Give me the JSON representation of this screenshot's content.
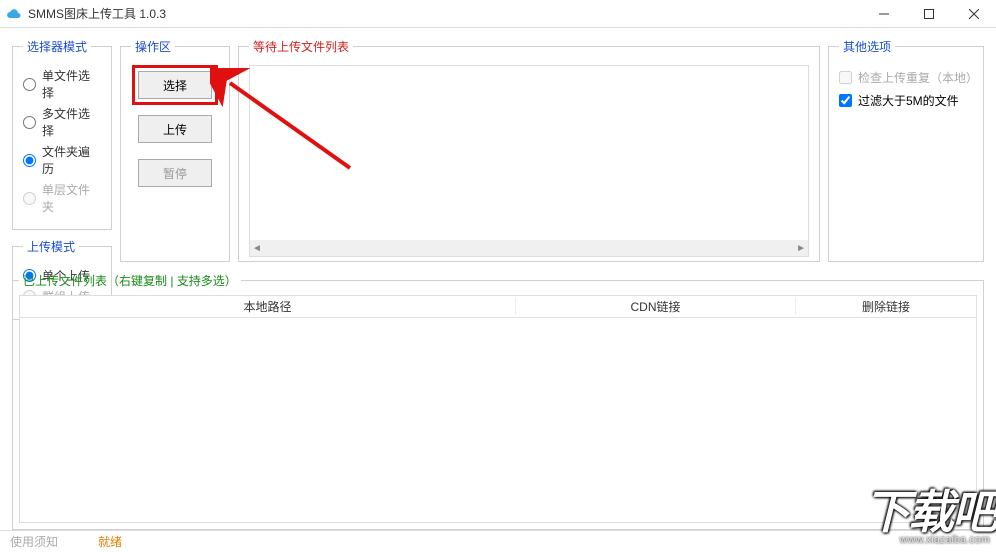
{
  "titlebar": {
    "title": "SMMS图床上传工具 1.0.3"
  },
  "selector_mode": {
    "legend": "选择器模式",
    "options": [
      {
        "label": "单文件选择",
        "disabled": false,
        "selected": false
      },
      {
        "label": "多文件选择",
        "disabled": false,
        "selected": false
      },
      {
        "label": "文件夹遍历",
        "disabled": false,
        "selected": true
      },
      {
        "label": "单层文件夹",
        "disabled": true,
        "selected": false
      }
    ]
  },
  "upload_mode": {
    "legend": "上传模式",
    "options": [
      {
        "label": "单个上传",
        "disabled": false,
        "selected": true
      },
      {
        "label": "群组上传",
        "disabled": true,
        "selected": false
      }
    ]
  },
  "ops": {
    "legend": "操作区",
    "select_label": "选择",
    "upload_label": "上传",
    "pause_label": "暂停"
  },
  "pending": {
    "legend": "等待上传文件列表"
  },
  "options": {
    "legend": "其他选项",
    "check_dup_label": "检查上传重复（本地）",
    "filter5m_label": "过滤大于5M的文件",
    "check_dup_checked": false,
    "filter5m_checked": true
  },
  "uploaded": {
    "legend": "已上传文件列表（右键复制 | 支持多选）",
    "col_path": "本地路径",
    "col_cdn": "CDN链接",
    "col_del": "删除链接"
  },
  "statusbar": {
    "hint": "使用须知",
    "status": "就绪"
  },
  "watermark": {
    "big": "下载吧",
    "small": "www.xiazaiba.com"
  }
}
